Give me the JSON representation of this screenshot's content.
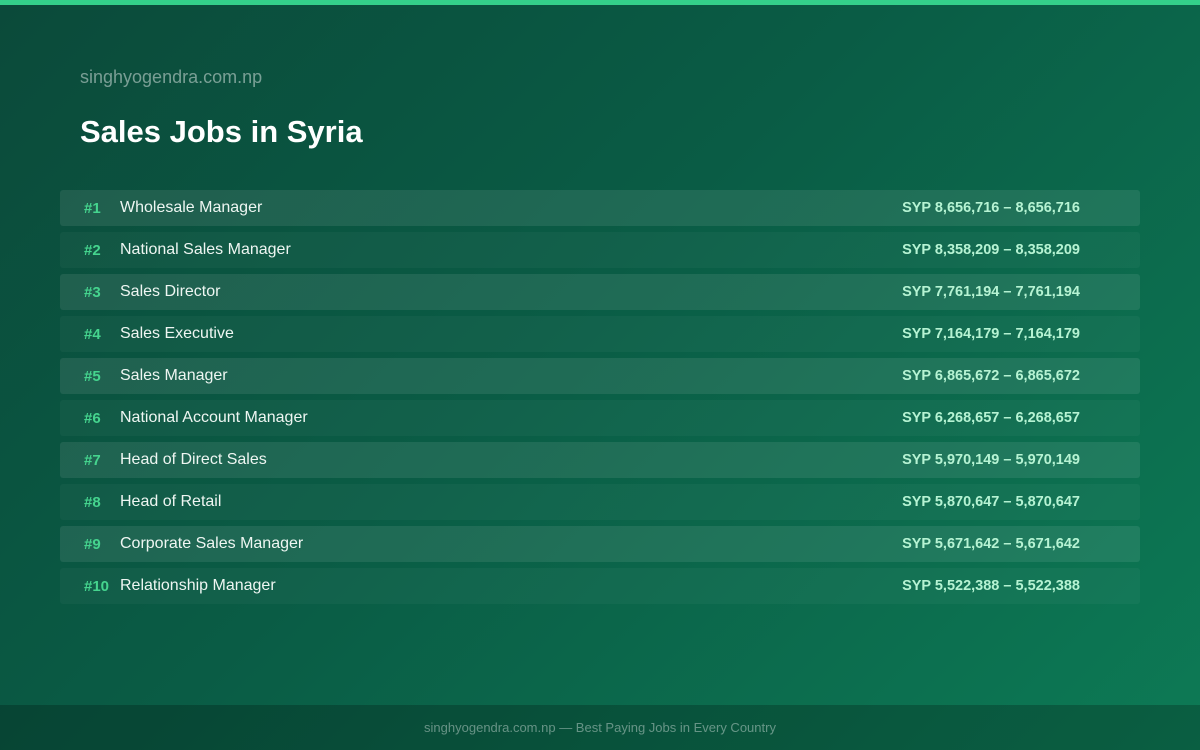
{
  "header": {
    "site_name": "singhyogendra.com.np",
    "title": "Sales Jobs in Syria"
  },
  "jobs": [
    {
      "rank": "#1",
      "title": "Wholesale Manager",
      "salary": "SYP 8,656,716 – 8,656,716"
    },
    {
      "rank": "#2",
      "title": "National Sales Manager",
      "salary": "SYP 8,358,209 – 8,358,209"
    },
    {
      "rank": "#3",
      "title": "Sales Director",
      "salary": "SYP 7,761,194 – 7,761,194"
    },
    {
      "rank": "#4",
      "title": "Sales Executive",
      "salary": "SYP 7,164,179 – 7,164,179"
    },
    {
      "rank": "#5",
      "title": "Sales Manager",
      "salary": "SYP 6,865,672 – 6,865,672"
    },
    {
      "rank": "#6",
      "title": "National Account Manager",
      "salary": "SYP 6,268,657 – 6,268,657"
    },
    {
      "rank": "#7",
      "title": "Head of Direct Sales",
      "salary": "SYP 5,970,149 – 5,970,149"
    },
    {
      "rank": "#8",
      "title": "Head of Retail",
      "salary": "SYP 5,870,647 – 5,870,647"
    },
    {
      "rank": "#9",
      "title": "Corporate Sales Manager",
      "salary": "SYP 5,671,642 – 5,671,642"
    },
    {
      "rank": "#10",
      "title": "Relationship Manager",
      "salary": "SYP 5,522,388 – 5,522,388"
    }
  ],
  "footer": {
    "text": "singhyogendra.com.np — Best Paying Jobs in Every Country"
  },
  "colors": {
    "accent": "#34d08a",
    "rank": "#45d48e",
    "salary": "#b6f3d3",
    "background": "#0a5c45"
  }
}
